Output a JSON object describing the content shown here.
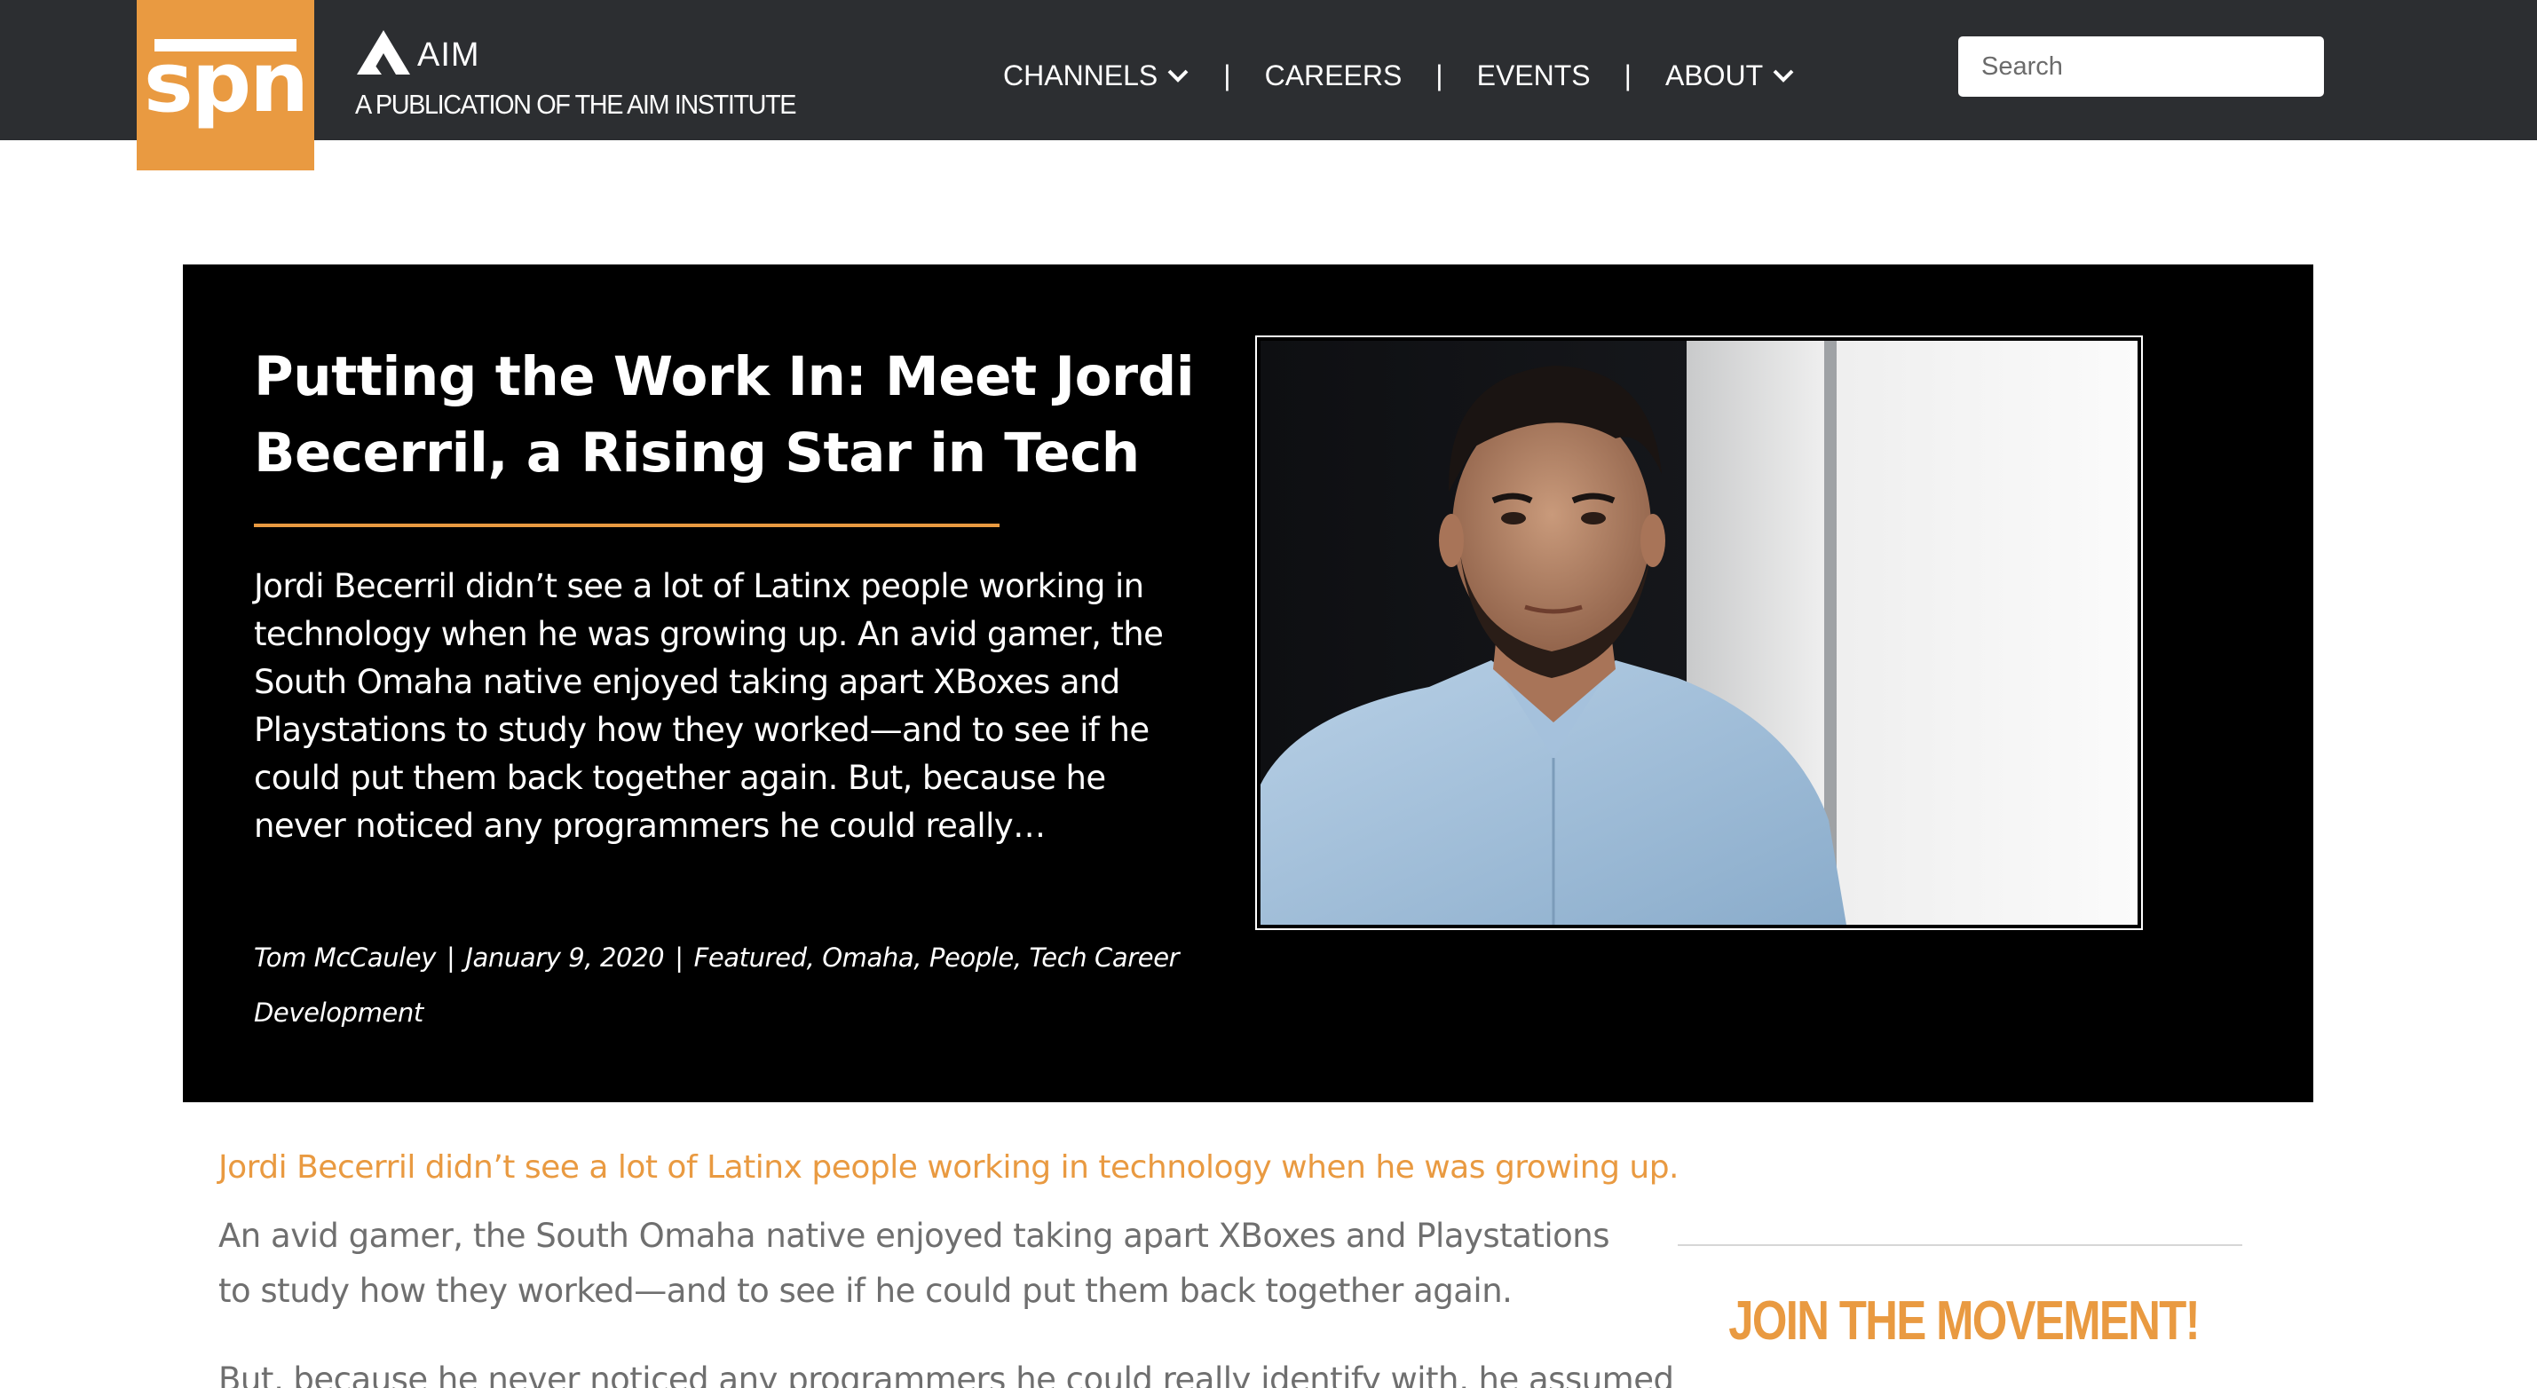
{
  "brand": {
    "logo_text": "spn",
    "aim_wordmark": "AIM",
    "publication_line": "A PUBLICATION OF THE AIM INSTITUTE",
    "accent_color": "#e99a41",
    "header_bg": "#2c2e31"
  },
  "nav": {
    "items": [
      {
        "label": "CHANNELS",
        "has_dropdown": true
      },
      {
        "label": "CAREERS",
        "has_dropdown": false
      },
      {
        "label": "EVENTS",
        "has_dropdown": false
      },
      {
        "label": "ABOUT",
        "has_dropdown": true
      }
    ],
    "separator": "|"
  },
  "search": {
    "placeholder": "Search",
    "value": ""
  },
  "hero": {
    "title": "Putting the Work In: Meet Jordi Becerril, a Rising Star in Tech",
    "excerpt": "Jordi Becerril didn’t see a lot of Latinx people working in technology when he was growing up. An avid gamer, the South Omaha native enjoyed taking apart XBoxes and Playstations to study how they worked—and to see if he could put them back together again.  But, because he never noticed any programmers he could really…",
    "author": "Tom McCauley",
    "date": "January 9, 2020",
    "categories": [
      "Featured",
      "Omaha",
      "People",
      "Tech Career Development"
    ],
    "photo_icon": "portrait-photo"
  },
  "article": {
    "lead": "Jordi Becerril didn’t see a lot of Latinx people working in technology when he was growing up.",
    "paragraph_1": "An avid gamer, the South Omaha native enjoyed taking apart XBoxes and Playstations to study how they worked—and to see if he could put them back together again.",
    "paragraph_2": "But, because he never noticed any programmers he could really identify with, he assumed"
  },
  "sidebar": {
    "cta_heading": "JOIN THE MOVEMENT!"
  }
}
